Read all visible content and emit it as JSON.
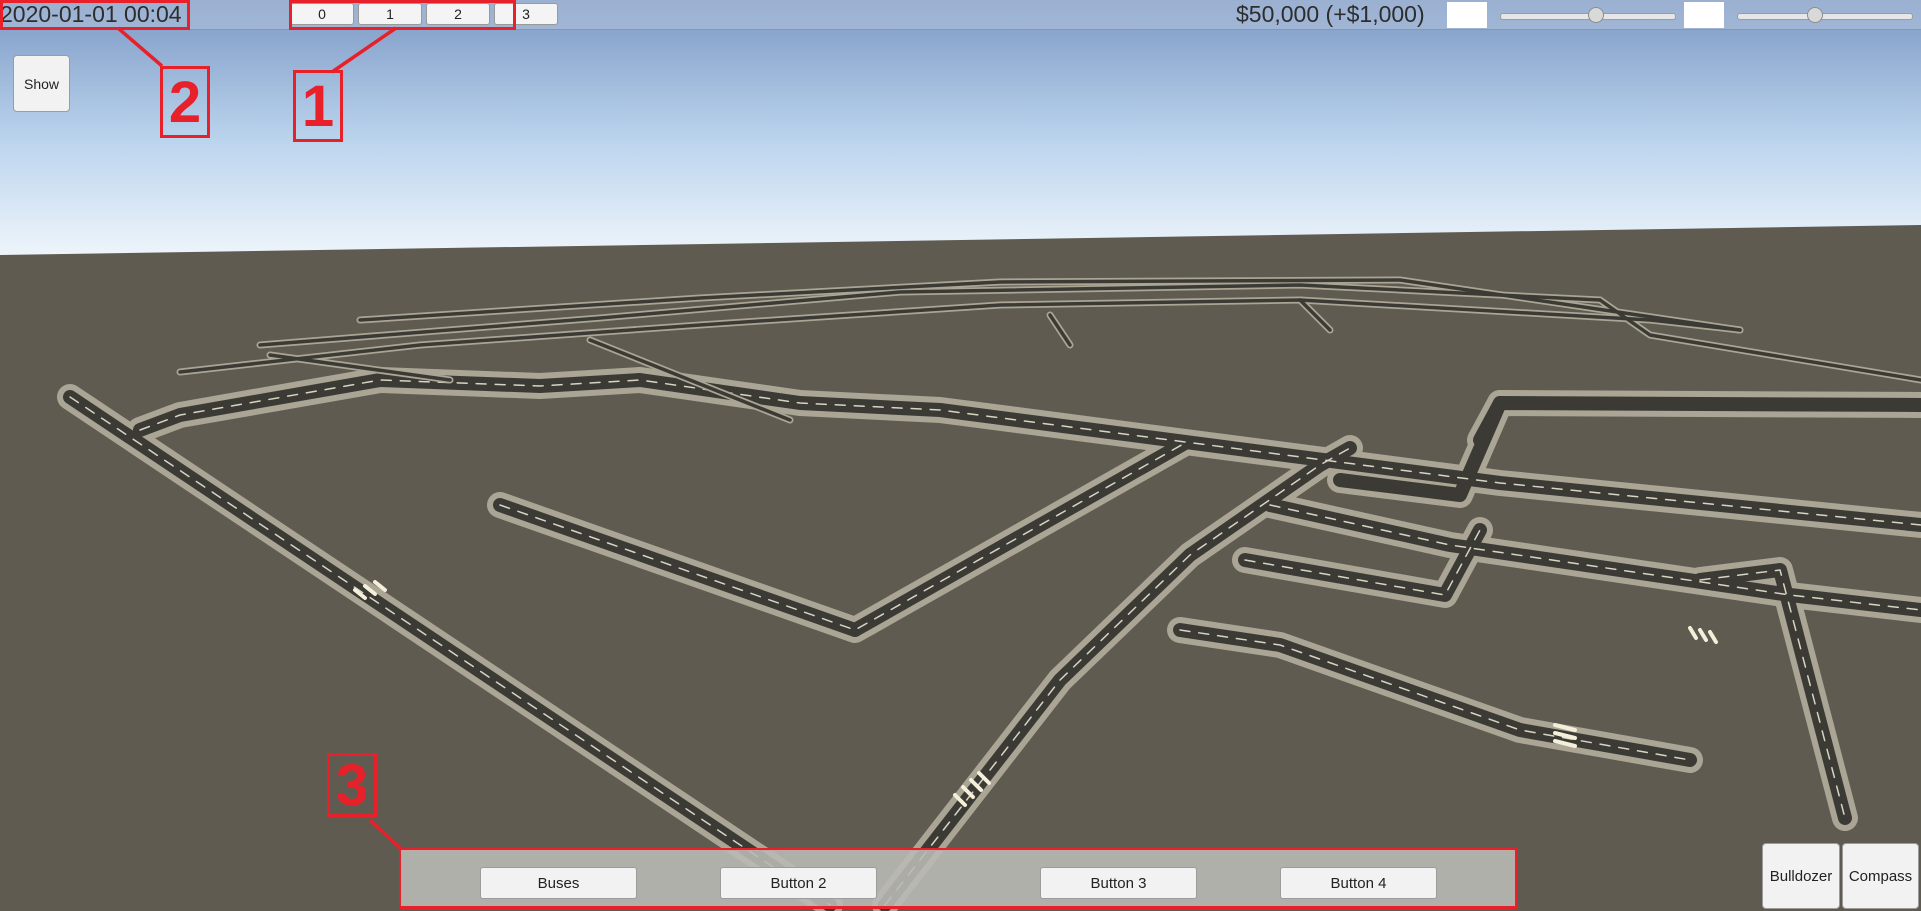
{
  "hud": {
    "datetime": "2020-01-01 00:04",
    "money": "$50,000 (+$1,000)",
    "speed_buttons": [
      "0",
      "1",
      "2",
      "3"
    ],
    "slider_1_value": 0.55,
    "slider_2_value": 0.44,
    "show_label": "Show"
  },
  "toolbar": {
    "buttons": [
      "Buses",
      "Button 2",
      "Button 3",
      "Button 4"
    ]
  },
  "corner_buttons": {
    "bulldozer": "Bulldozer",
    "compass": "Compass"
  },
  "annotations": [
    "1",
    "2",
    "3"
  ],
  "colors": {
    "annotation": "#e8202a",
    "ground": "#5f5b51",
    "road": "#3b3a35",
    "sidewalk": "#aaa594"
  }
}
